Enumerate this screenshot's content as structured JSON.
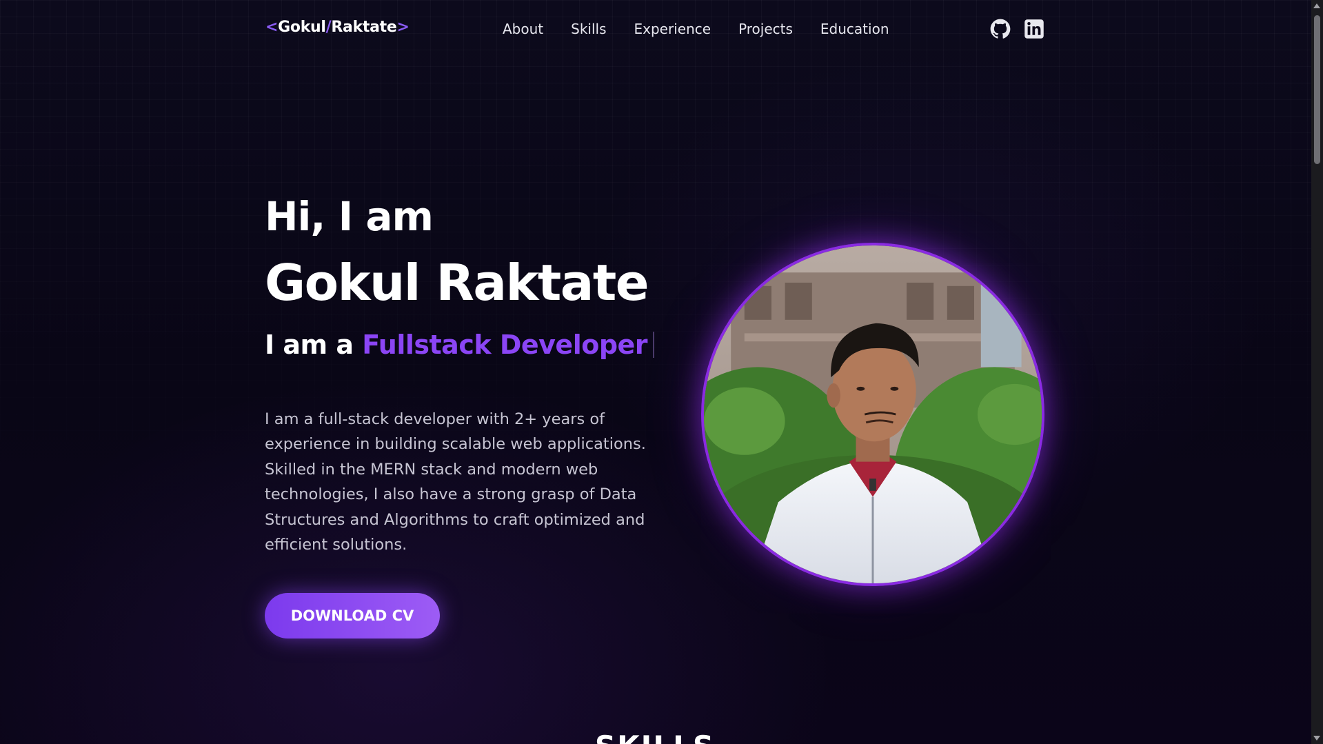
{
  "header": {
    "logo": {
      "open": "<",
      "first": "Gokul",
      "slash": "/",
      "last": "Raktate",
      "close": ">"
    },
    "nav": [
      {
        "label": "About"
      },
      {
        "label": "Skills"
      },
      {
        "label": "Experience"
      },
      {
        "label": "Projects"
      },
      {
        "label": "Education"
      }
    ],
    "socials": [
      {
        "icon": "github-icon"
      },
      {
        "icon": "linkedin-icon"
      }
    ]
  },
  "hero": {
    "greeting": "Hi, I am",
    "name": "Gokul Raktate",
    "role_prefix": "I am a ",
    "role": "Fullstack Developer",
    "description": "I am a full-stack developer with 2+ years of experience in building scalable web applications. Skilled in the MERN stack and modern web technologies, I also have a strong grasp of Data Structures and Algorithms to craft optimized and efficient solutions.",
    "cta_label": "DOWNLOAD CV"
  },
  "next_section": {
    "title": "SKILLS"
  },
  "colors": {
    "accent": "#8b45f5",
    "background": "#0a0618",
    "avatar_ring": "#8a2be2"
  }
}
